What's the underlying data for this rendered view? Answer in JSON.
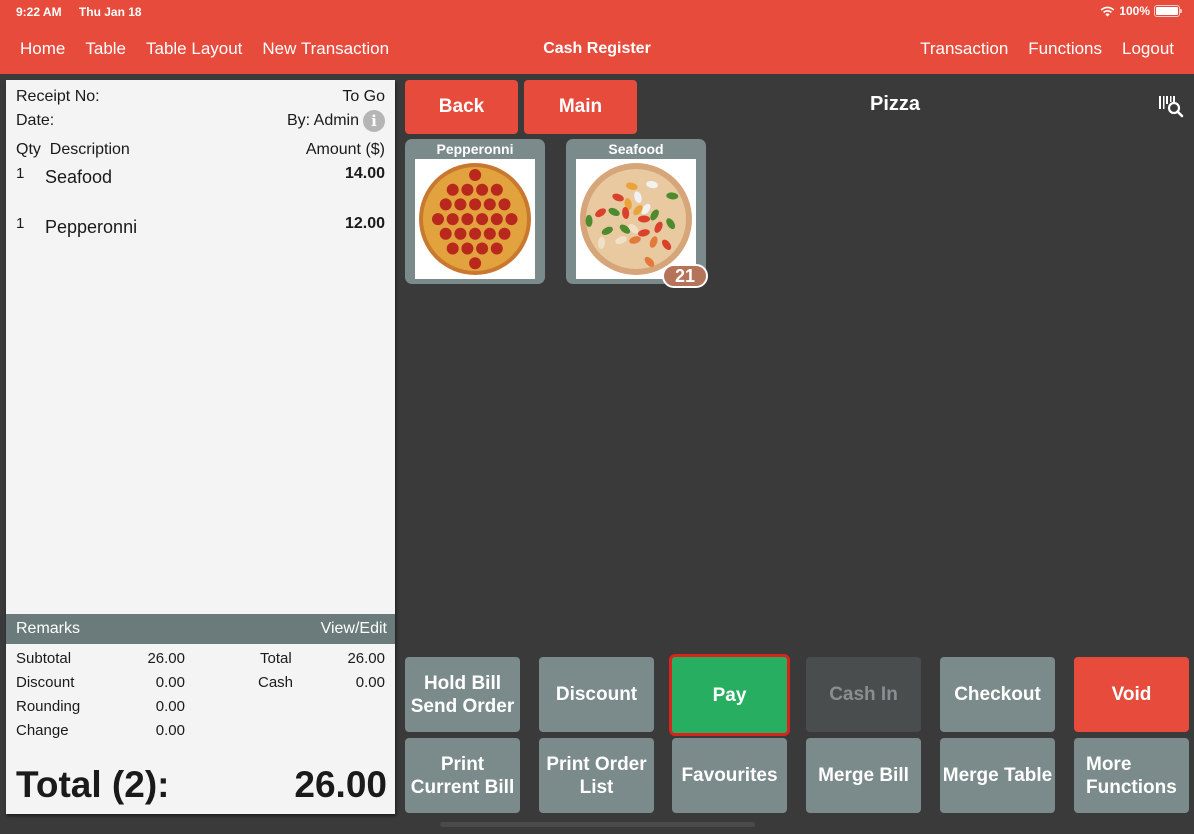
{
  "status_bar": {
    "time": "9:22 AM",
    "date": "Thu Jan 18",
    "battery": "100%",
    "battery_level": 1.0
  },
  "nav": {
    "left": [
      "Home",
      "Table",
      "Table Layout",
      "New Transaction"
    ],
    "title": "Cash Register",
    "right": [
      "Transaction",
      "Functions",
      "Logout"
    ]
  },
  "receipt": {
    "receipt_no_label": "Receipt No:",
    "order_type": "To Go",
    "date_label": "Date:",
    "by": "By: Admin",
    "col_qty": "Qty",
    "col_desc": "Description",
    "col_amount": "Amount ($)",
    "items": [
      {
        "qty": "1",
        "desc": "Seafood",
        "amount": "14.00"
      },
      {
        "qty": "1",
        "desc": "Pepperonni",
        "amount": "12.00"
      }
    ],
    "remarks_label": "Remarks",
    "remarks_action": "View/Edit",
    "summary_left": [
      {
        "label": "Subtotal",
        "value": "26.00"
      },
      {
        "label": "Discount",
        "value": "0.00"
      },
      {
        "label": "Rounding",
        "value": "0.00"
      },
      {
        "label": "Change",
        "value": "0.00"
      }
    ],
    "summary_right": [
      {
        "label": "Total",
        "value": "26.00"
      },
      {
        "label": "Cash",
        "value": "0.00"
      }
    ],
    "grand_label": "Total (2):",
    "grand_value": "26.00"
  },
  "category": {
    "back_label": "Back",
    "main_label": "Main",
    "title": "Pizza"
  },
  "products": [
    {
      "name": "Pepperonni",
      "badge": null
    },
    {
      "name": "Seafood",
      "badge": "21"
    }
  ],
  "functions": {
    "row1": [
      "Hold Bill\nSend Order",
      "Discount",
      "Pay",
      "Cash In",
      "Checkout",
      "Void"
    ],
    "row2": [
      "Print\nCurrent Bill",
      "Print Order\nList",
      "Favourites",
      "Merge Bill",
      "Merge Table",
      "More\nFunctions"
    ]
  },
  "colors": {
    "brand": "#e64b3c",
    "pay": "#28ae60",
    "button": "#7b8a8a"
  }
}
